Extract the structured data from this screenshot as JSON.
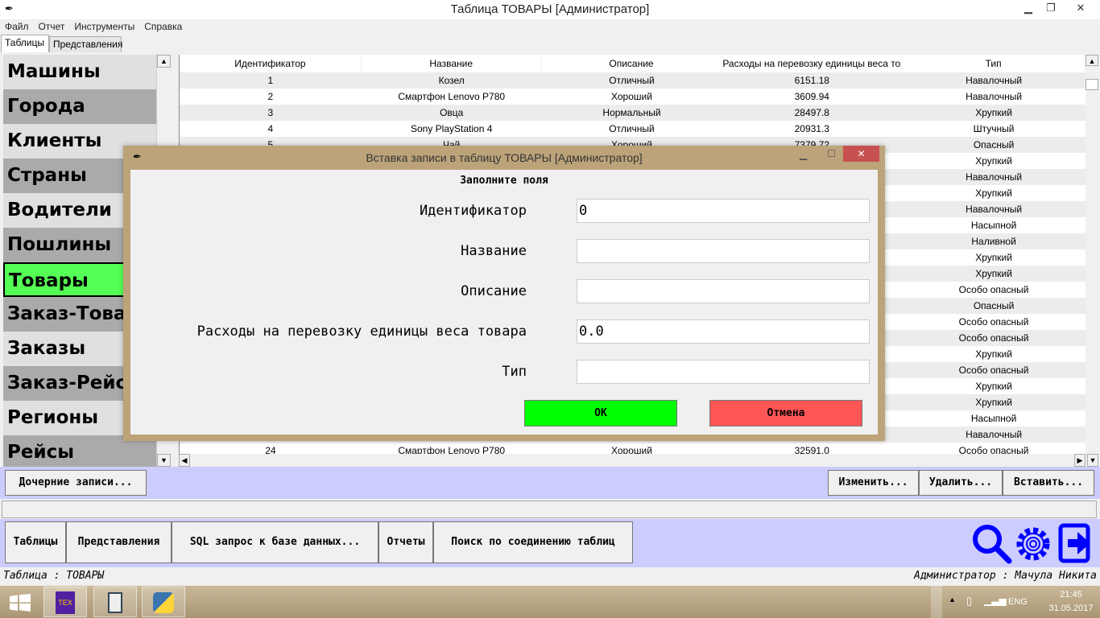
{
  "window": {
    "title": "Таблица ТОВАРЫ [Администратор]",
    "minimize": "▁",
    "maximize": "❐",
    "close": "✕"
  },
  "menu": [
    "Файл",
    "Отчет",
    "Инструменты",
    "Справка"
  ],
  "tabs": [
    "Таблицы",
    "Представления"
  ],
  "sidebar": {
    "items": [
      "Машины",
      "Города",
      "Клиенты",
      "Страны",
      "Водители",
      "Пошлины",
      "Товары",
      "Заказ-Товар",
      "Заказы",
      "Заказ-Рейс",
      "Регионы",
      "Рейсы"
    ],
    "selected": "Товары"
  },
  "table": {
    "headers": [
      "Идентификатор",
      "Название",
      "Описание",
      "Расходы на перевозку единицы веса то",
      "Тип"
    ],
    "rows": [
      [
        "1",
        "Козел",
        "Отличный",
        "6151.18",
        "Навалочный"
      ],
      [
        "2",
        "Смартфон Lenovo P780",
        "Хороший",
        "3609.94",
        "Навалочный"
      ],
      [
        "3",
        "Овца",
        "Нормальный",
        "28497.8",
        "Хрупкий"
      ],
      [
        "4",
        "Sony PlayStation 4",
        "Отличный",
        "20931.3",
        "Штучный"
      ],
      [
        "5",
        "Чай",
        "Хороший",
        "7379.72",
        "Опасный"
      ],
      [
        "",
        "",
        "",
        "",
        "Хрупкий"
      ],
      [
        "",
        "",
        "",
        "",
        "Навалочный"
      ],
      [
        "",
        "",
        "",
        "",
        "Хрупкий"
      ],
      [
        "",
        "",
        "",
        "",
        "Навалочный"
      ],
      [
        "",
        "",
        "",
        "",
        "Насыпной"
      ],
      [
        "",
        "",
        "",
        "",
        "Наливной"
      ],
      [
        "",
        "",
        "",
        "",
        "Хрупкий"
      ],
      [
        "",
        "",
        "",
        "",
        "Хрупкий"
      ],
      [
        "",
        "",
        "",
        "",
        "Особо опасный"
      ],
      [
        "",
        "",
        "",
        "",
        "Опасный"
      ],
      [
        "",
        "",
        "",
        "",
        "Особо опасный"
      ],
      [
        "",
        "",
        "",
        "",
        "Особо опасный"
      ],
      [
        "",
        "",
        "",
        "",
        "Хрупкий"
      ],
      [
        "",
        "",
        "",
        "",
        "Особо опасный"
      ],
      [
        "",
        "",
        "",
        "",
        "Хрупкий"
      ],
      [
        "",
        "",
        "",
        "",
        "Хрупкий"
      ],
      [
        "",
        "",
        "",
        "",
        "Насыпной"
      ],
      [
        "",
        "",
        "",
        "",
        "Навалочный"
      ],
      [
        "24",
        "Смартфон Lenovo P780",
        "Хороший",
        "32591.0",
        "Особо опасный"
      ]
    ]
  },
  "actions": {
    "children": "Дочерние записи...",
    "edit": "Изменить...",
    "delete": "Удалить...",
    "insert": "Вставить..."
  },
  "bottom": {
    "tables": "Таблицы",
    "views": "Представления",
    "sql": "SQL запрос к базе данных...",
    "reports": "Отчеты",
    "join_search": "Поиск по соединению таблиц"
  },
  "status": {
    "left": "Таблица : ТОВАРЫ",
    "right": "Администратор : Мачула Никита"
  },
  "dialog": {
    "title": "Вставка записи в таблицу ТОВАРЫ [Администратор]",
    "heading": "Заполните поля",
    "fields": [
      {
        "label": "Идентификатор",
        "value": "0"
      },
      {
        "label": "Название",
        "value": ""
      },
      {
        "label": "Описание",
        "value": ""
      },
      {
        "label": "Расходы на перевозку единицы веса товара",
        "value": "0.0"
      },
      {
        "label": "Тип",
        "value": ""
      }
    ],
    "ok": "OK",
    "cancel": "Отмена"
  },
  "taskbar": {
    "lang": "ENG",
    "time": "21:45",
    "date": "31.05.2017"
  },
  "colors": {
    "selected": "#55ff55",
    "ok": "#00ff00",
    "cancel": "#ff5555",
    "band": "#ccccff",
    "icons": "#0000ff"
  }
}
